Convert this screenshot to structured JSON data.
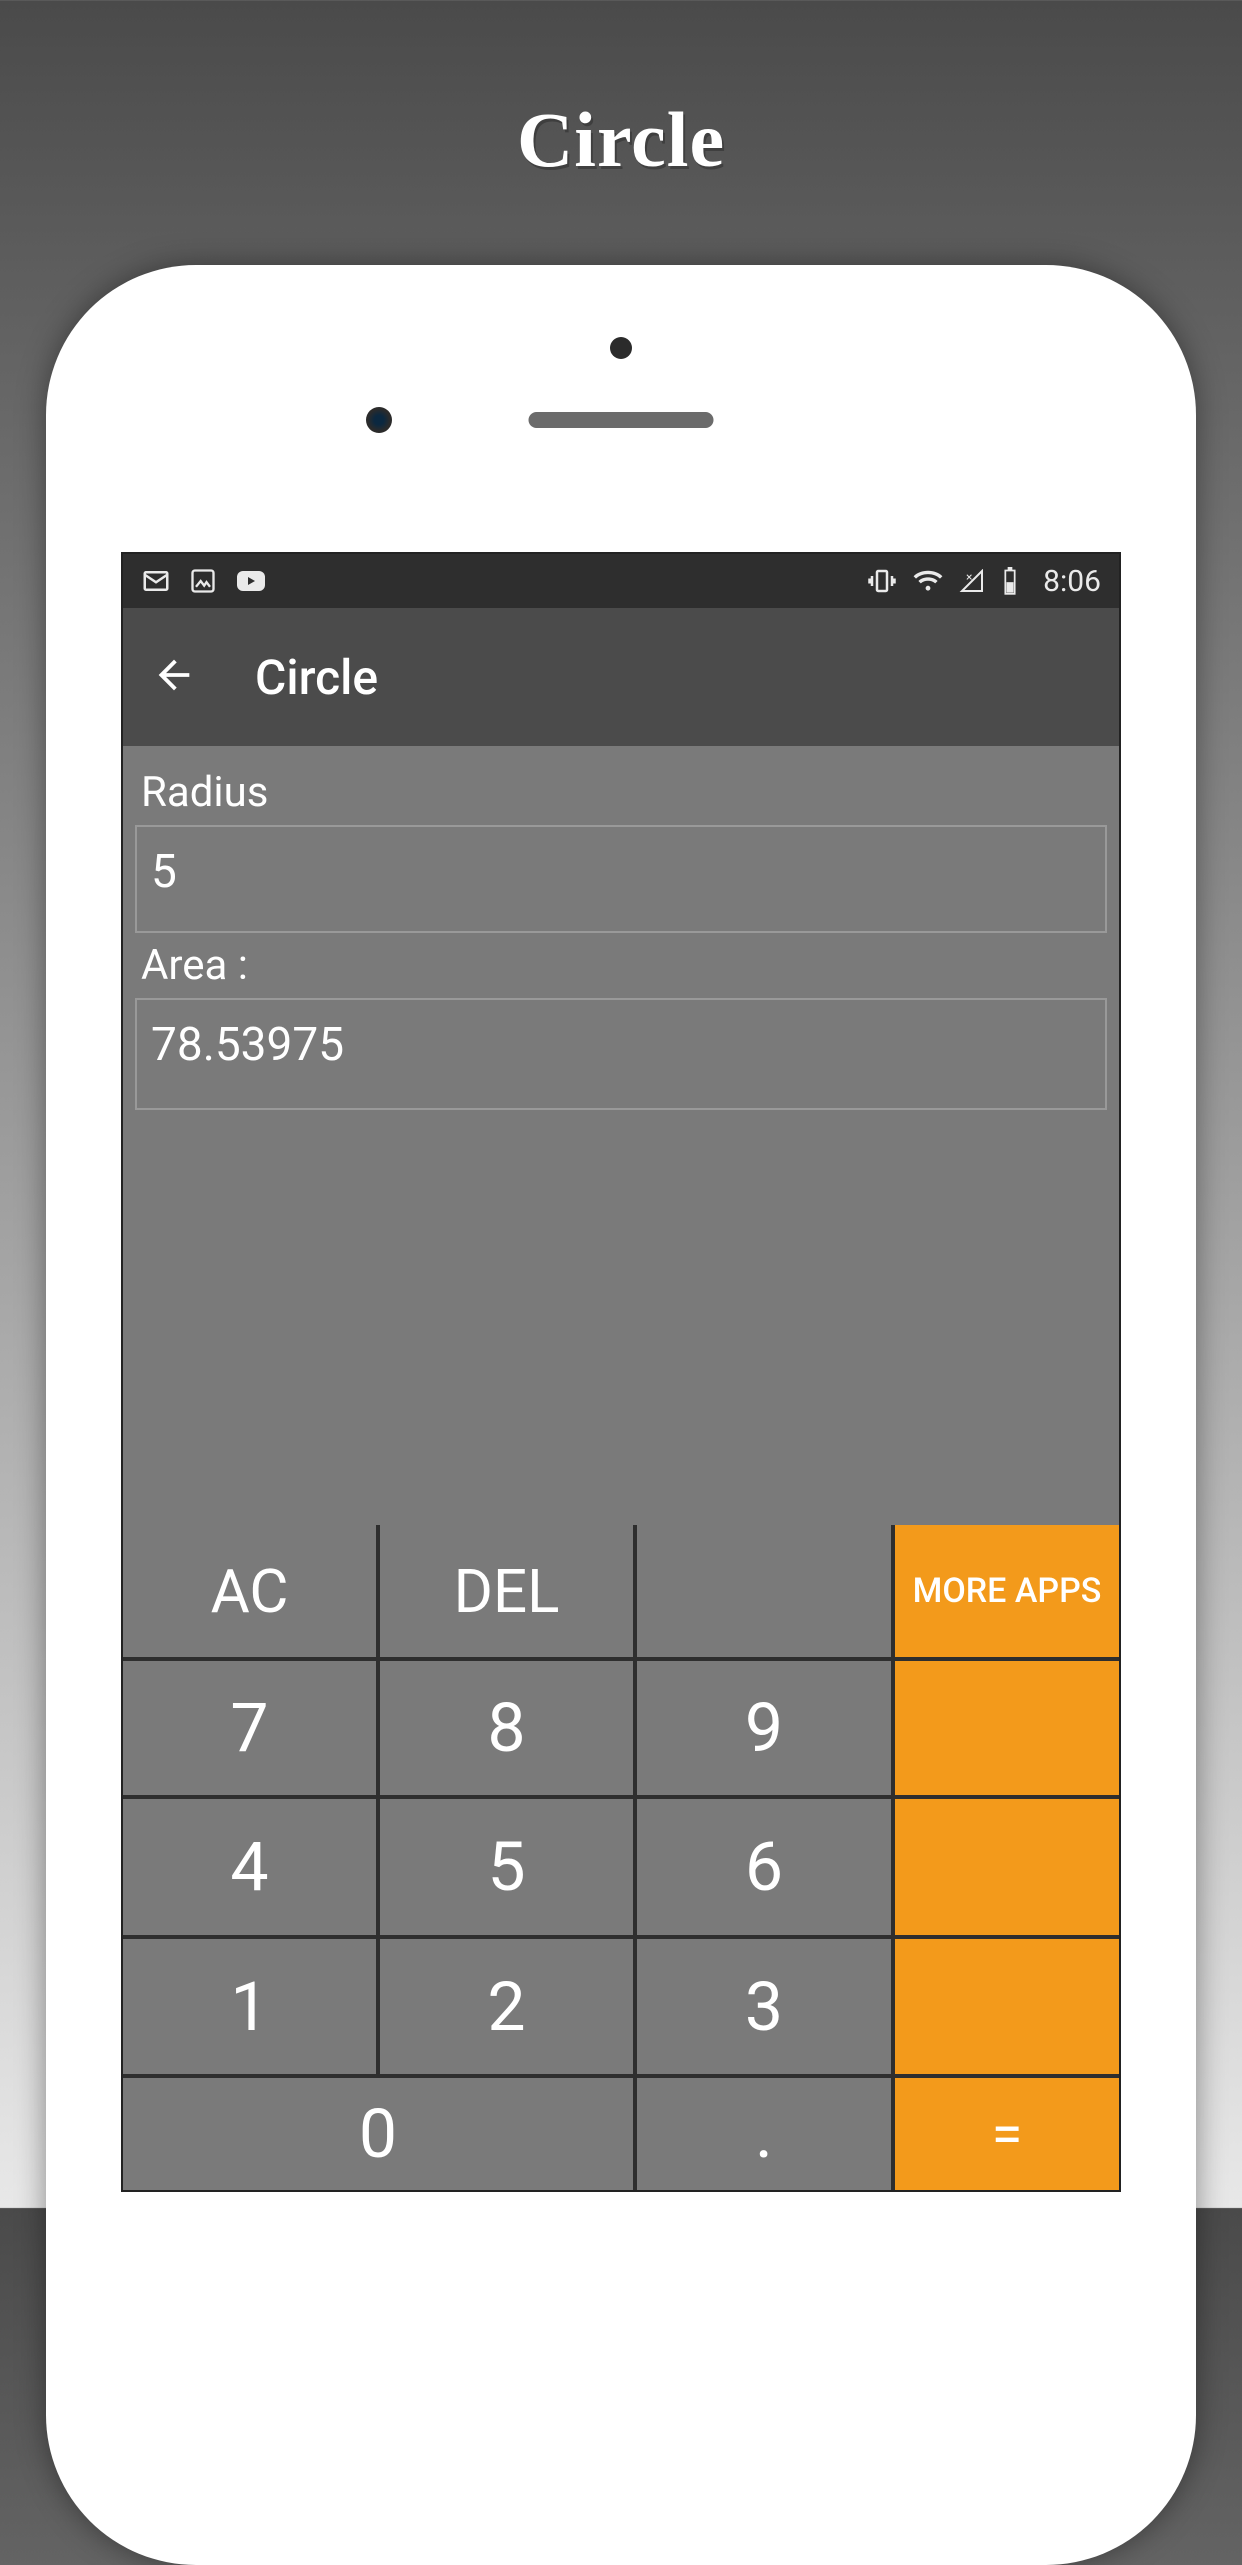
{
  "page_title": "Circle",
  "status_bar": {
    "time": "8:06"
  },
  "action_bar": {
    "title": "Circle"
  },
  "fields": {
    "radius_label": "Radius",
    "radius_value": "5",
    "area_label": "Area :",
    "area_value": "78.53975"
  },
  "keypad": {
    "ac": "AC",
    "del": "DEL",
    "more_apps": "MORE APPS",
    "k7": "7",
    "k8": "8",
    "k9": "9",
    "k4": "4",
    "k5": "5",
    "k6": "6",
    "k1": "1",
    "k2": "2",
    "k3": "3",
    "k0": "0",
    "dot": ".",
    "equals": "="
  }
}
